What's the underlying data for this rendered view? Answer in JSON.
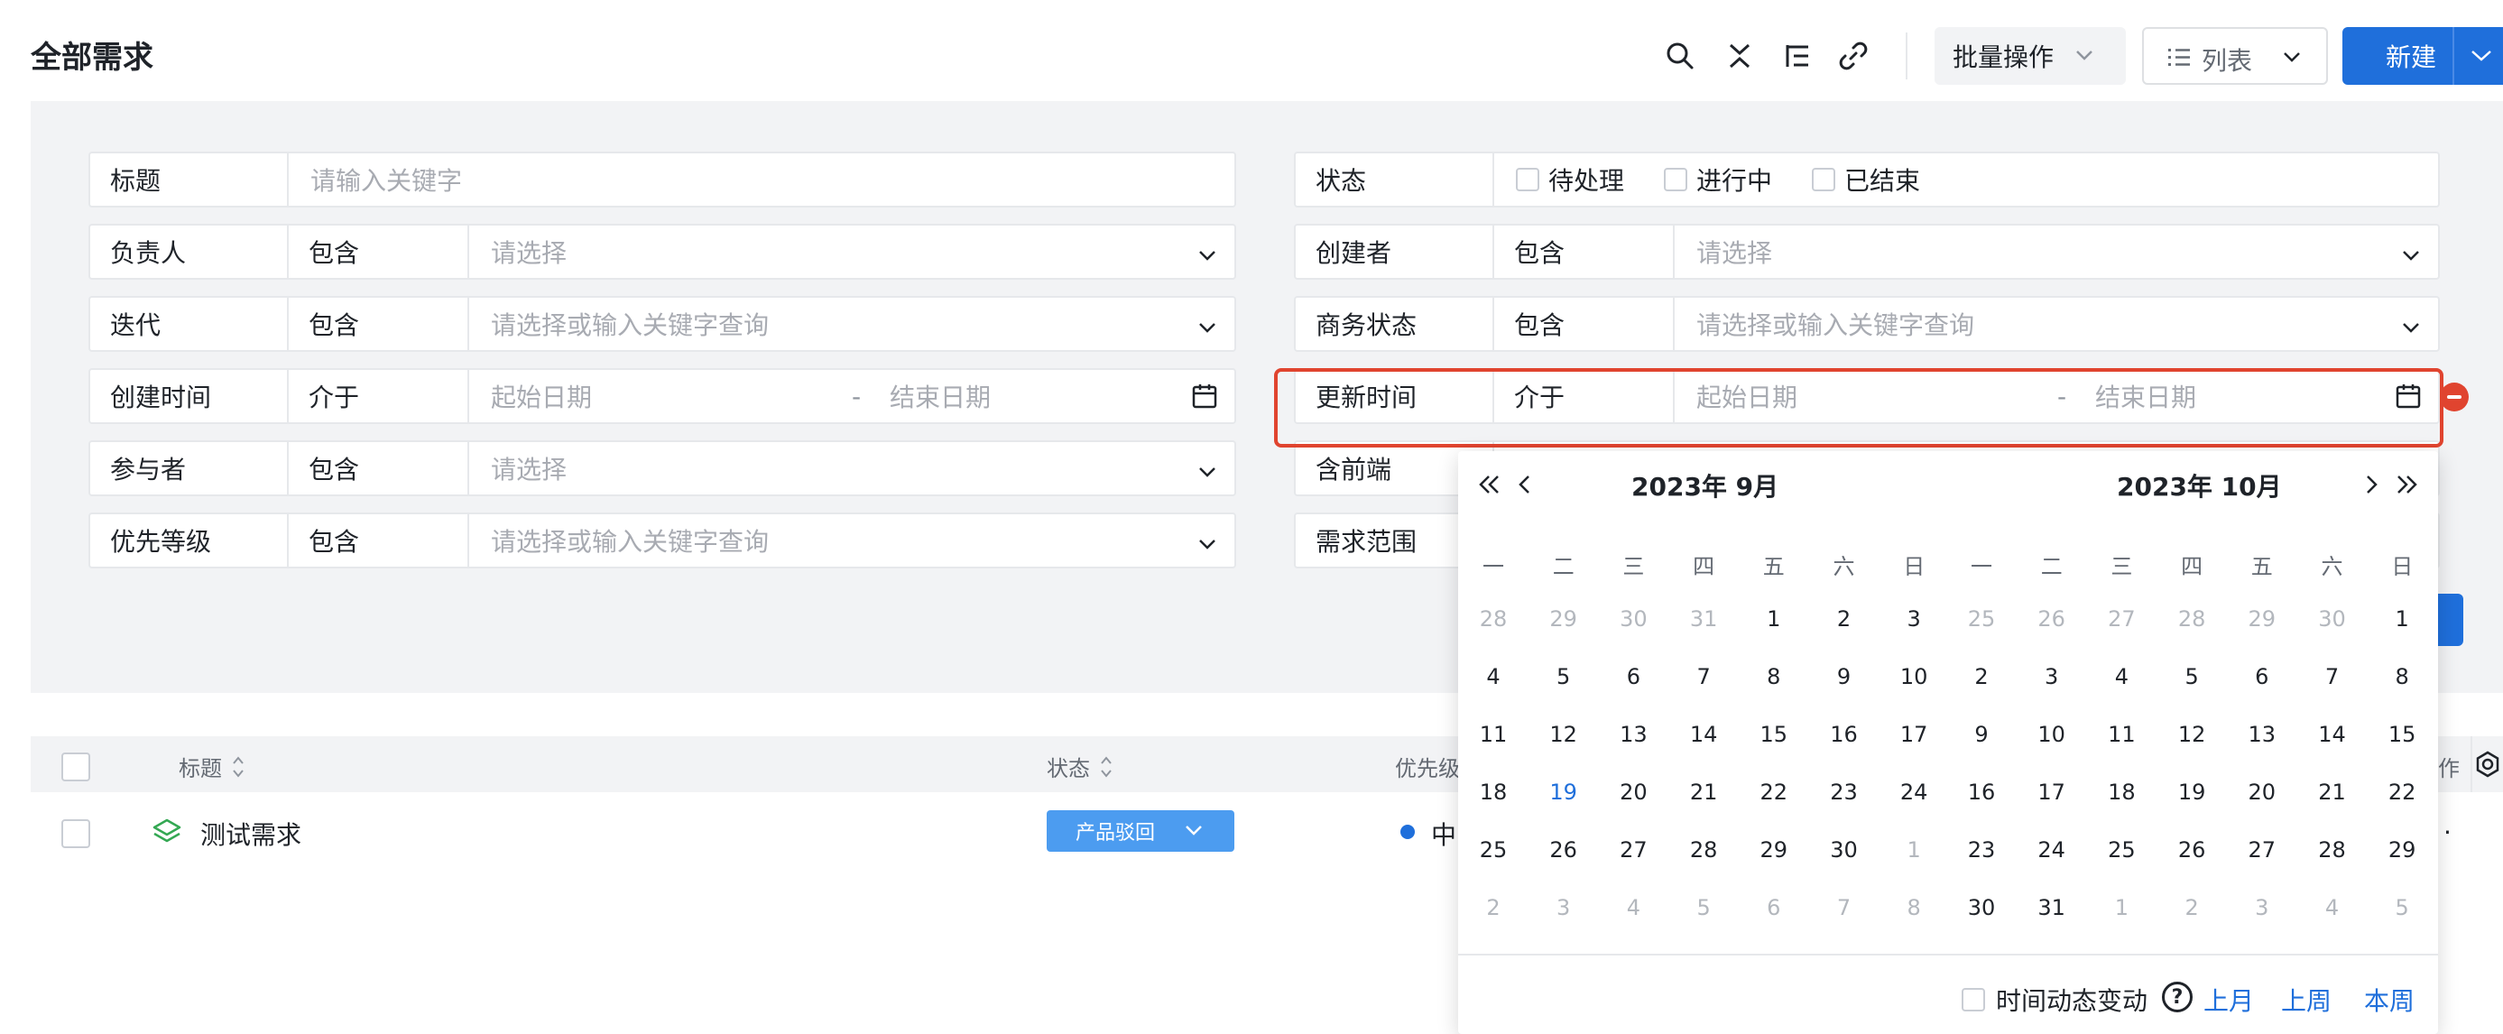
{
  "header": {
    "title": "全部需求",
    "batch_label": "批量操作",
    "view_label": "列表",
    "new_label": "新建"
  },
  "filters": {
    "left": [
      {
        "label": "标题",
        "op": "",
        "value": "请输入关键字",
        "kind": "text"
      },
      {
        "label": "负责人",
        "op": "包含",
        "value": "请选择",
        "kind": "select"
      },
      {
        "label": "迭代",
        "op": "包含",
        "value": "请选择或输入关键字查询",
        "kind": "select"
      },
      {
        "label": "创建时间",
        "op": "介于",
        "start": "起始日期",
        "end": "结束日期",
        "kind": "date"
      },
      {
        "label": "参与者",
        "op": "包含",
        "value": "请选择",
        "kind": "select"
      },
      {
        "label": "优先等级",
        "op": "包含",
        "value": "请选择或输入关键字查询",
        "kind": "select"
      }
    ],
    "right": [
      {
        "label": "状态",
        "kind": "checks",
        "options": [
          "待处理",
          "进行中",
          "已结束"
        ]
      },
      {
        "label": "创建者",
        "op": "包含",
        "value": "请选择",
        "kind": "select"
      },
      {
        "label": "商务状态",
        "op": "包含",
        "value": "请选择或输入关键字查询",
        "kind": "select"
      },
      {
        "label": "更新时间",
        "op": "介于",
        "start": "起始日期",
        "end": "结束日期",
        "kind": "date"
      },
      {
        "label": "含前端",
        "kind": "partial"
      },
      {
        "label": "需求范围",
        "kind": "partial"
      }
    ],
    "date_sep": "-"
  },
  "table": {
    "columns": {
      "title": "标题",
      "status": "状态",
      "priority": "优先级",
      "ops": "作"
    },
    "rows": [
      {
        "title": "测试需求",
        "status": "产品驳回",
        "priority": "中"
      }
    ]
  },
  "calendar": {
    "left_title": "2023年 9月",
    "right_title": "2023年 10月",
    "weekdays": [
      "一",
      "二",
      "三",
      "四",
      "五",
      "六",
      "日"
    ],
    "left_days": [
      [
        [
          "28",
          "out"
        ],
        [
          "29",
          "out"
        ],
        [
          "30",
          "out"
        ],
        [
          "31",
          "out"
        ],
        [
          "1",
          "in"
        ],
        [
          "2",
          "in"
        ],
        [
          "3",
          "in"
        ]
      ],
      [
        [
          "4",
          "in"
        ],
        [
          "5",
          "in"
        ],
        [
          "6",
          "in"
        ],
        [
          "7",
          "in"
        ],
        [
          "8",
          "in"
        ],
        [
          "9",
          "in"
        ],
        [
          "10",
          "in"
        ]
      ],
      [
        [
          "11",
          "in"
        ],
        [
          "12",
          "in"
        ],
        [
          "13",
          "in"
        ],
        [
          "14",
          "in"
        ],
        [
          "15",
          "in"
        ],
        [
          "16",
          "in"
        ],
        [
          "17",
          "in"
        ]
      ],
      [
        [
          "18",
          "in"
        ],
        [
          "19",
          "today"
        ],
        [
          "20",
          "in"
        ],
        [
          "21",
          "in"
        ],
        [
          "22",
          "in"
        ],
        [
          "23",
          "in"
        ],
        [
          "24",
          "in"
        ]
      ],
      [
        [
          "25",
          "in"
        ],
        [
          "26",
          "in"
        ],
        [
          "27",
          "in"
        ],
        [
          "28",
          "in"
        ],
        [
          "29",
          "in"
        ],
        [
          "30",
          "in"
        ],
        [
          "1",
          "out"
        ]
      ],
      [
        [
          "2",
          "out"
        ],
        [
          "3",
          "out"
        ],
        [
          "4",
          "out"
        ],
        [
          "5",
          "out"
        ],
        [
          "6",
          "out"
        ],
        [
          "7",
          "out"
        ],
        [
          "8",
          "out"
        ]
      ]
    ],
    "right_days": [
      [
        [
          "25",
          "out"
        ],
        [
          "26",
          "out"
        ],
        [
          "27",
          "out"
        ],
        [
          "28",
          "out"
        ],
        [
          "29",
          "out"
        ],
        [
          "30",
          "out"
        ],
        [
          "1",
          "in"
        ]
      ],
      [
        [
          "2",
          "in"
        ],
        [
          "3",
          "in"
        ],
        [
          "4",
          "in"
        ],
        [
          "5",
          "in"
        ],
        [
          "6",
          "in"
        ],
        [
          "7",
          "in"
        ],
        [
          "8",
          "in"
        ]
      ],
      [
        [
          "9",
          "in"
        ],
        [
          "10",
          "in"
        ],
        [
          "11",
          "in"
        ],
        [
          "12",
          "in"
        ],
        [
          "13",
          "in"
        ],
        [
          "14",
          "in"
        ],
        [
          "15",
          "in"
        ]
      ],
      [
        [
          "16",
          "in"
        ],
        [
          "17",
          "in"
        ],
        [
          "18",
          "in"
        ],
        [
          "19",
          "in"
        ],
        [
          "20",
          "in"
        ],
        [
          "21",
          "in"
        ],
        [
          "22",
          "in"
        ]
      ],
      [
        [
          "23",
          "in"
        ],
        [
          "24",
          "in"
        ],
        [
          "25",
          "in"
        ],
        [
          "26",
          "in"
        ],
        [
          "27",
          "in"
        ],
        [
          "28",
          "in"
        ],
        [
          "29",
          "in"
        ]
      ],
      [
        [
          "30",
          "in"
        ],
        [
          "31",
          "in"
        ],
        [
          "1",
          "out"
        ],
        [
          "2",
          "out"
        ],
        [
          "3",
          "out"
        ],
        [
          "4",
          "out"
        ],
        [
          "5",
          "out"
        ]
      ]
    ],
    "dynamic_label": "时间动态变动",
    "help_glyph": "?",
    "quick": [
      "上月",
      "上周",
      "本周"
    ]
  },
  "colors": {
    "accent": "#1f6fdb",
    "highlight": "#e0442f",
    "badge": "#4c9cf0",
    "panel": "#f2f3f5"
  },
  "icons": [
    "search-icon",
    "collapse-icon",
    "tree-list-icon",
    "link-icon",
    "list-icon",
    "chevron-down-icon",
    "calendar-icon",
    "minus-circle-icon",
    "double-left-icon",
    "left-icon",
    "right-icon",
    "double-right-icon",
    "settings-icon",
    "layers-icon",
    "help-icon"
  ]
}
